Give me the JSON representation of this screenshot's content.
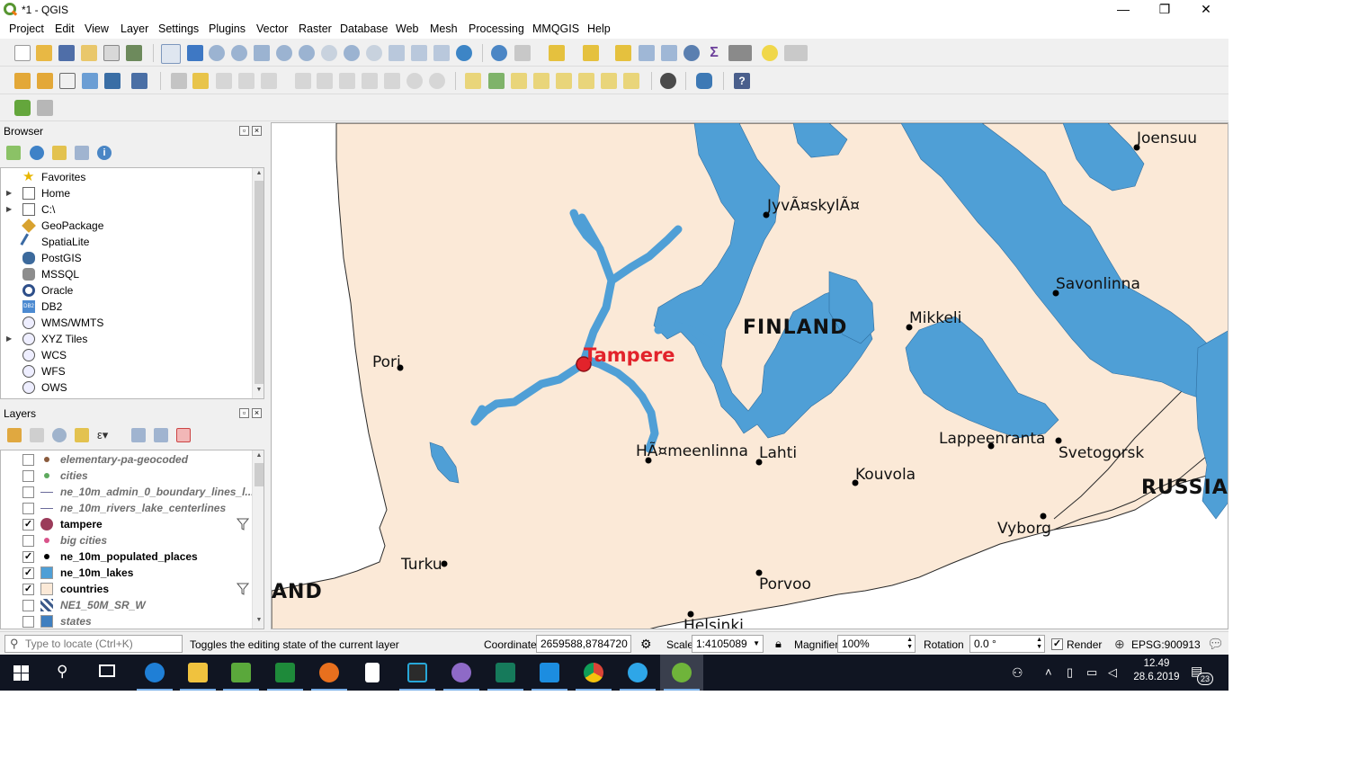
{
  "window": {
    "title": "*1 - QGIS",
    "min_glyph": "—",
    "max_glyph": "❐",
    "close_glyph": "✕"
  },
  "menu": [
    "Project",
    "Edit",
    "View",
    "Layer",
    "Settings",
    "Plugins",
    "Vector",
    "Raster",
    "Database",
    "Web",
    "Mesh",
    "Processing",
    "MMQGIS",
    "Help"
  ],
  "browser": {
    "title": "Browser",
    "items": [
      {
        "label": "Favorites",
        "icon": "star-icon",
        "expandable": false
      },
      {
        "label": "Home",
        "icon": "home-folder-icon",
        "expandable": true
      },
      {
        "label": "C:\\",
        "icon": "drive-folder-icon",
        "expandable": true
      },
      {
        "label": "GeoPackage",
        "icon": "geopackage-icon",
        "expandable": false
      },
      {
        "label": "SpatiaLite",
        "icon": "spatialite-icon",
        "expandable": false
      },
      {
        "label": "PostGIS",
        "icon": "postgis-icon",
        "expandable": false
      },
      {
        "label": "MSSQL",
        "icon": "mssql-icon",
        "expandable": false
      },
      {
        "label": "Oracle",
        "icon": "oracle-icon",
        "expandable": false
      },
      {
        "label": "DB2",
        "icon": "db2-icon",
        "expandable": false
      },
      {
        "label": "WMS/WMTS",
        "icon": "globe-icon",
        "expandable": false
      },
      {
        "label": "XYZ Tiles",
        "icon": "globe-icon",
        "expandable": true
      },
      {
        "label": "WCS",
        "icon": "globe-icon",
        "expandable": false
      },
      {
        "label": "WFS",
        "icon": "globe-icon",
        "expandable": false
      },
      {
        "label": "OWS",
        "icon": "globe-icon",
        "expandable": false
      }
    ]
  },
  "layers": {
    "title": "Layers",
    "items": [
      {
        "name": "elementary-pa-geocoded",
        "checked": false,
        "symbol": "dot",
        "color": "#8a5a3c",
        "filter": false
      },
      {
        "name": "cities",
        "checked": false,
        "symbol": "dot",
        "color": "#5ea95e",
        "filter": false
      },
      {
        "name": "ne_10m_admin_0_boundary_lines_l...",
        "checked": false,
        "symbol": "line",
        "color": "#6b6b9a",
        "filter": false
      },
      {
        "name": "ne_10m_rivers_lake_centerlines",
        "checked": false,
        "symbol": "line",
        "color": "#6b6b9a",
        "filter": false
      },
      {
        "name": "tampere",
        "checked": true,
        "symbol": "bigdot",
        "color": "#9b3b5a",
        "filter": true
      },
      {
        "name": "big cities",
        "checked": false,
        "symbol": "dot",
        "color": "#d9538a",
        "filter": false
      },
      {
        "name": "ne_10m_populated_places",
        "checked": true,
        "symbol": "dot",
        "color": "#000000",
        "filter": false
      },
      {
        "name": "ne_10m_lakes",
        "checked": true,
        "symbol": "fill",
        "color": "#4f9fd6",
        "filter": false
      },
      {
        "name": "countries",
        "checked": true,
        "symbol": "fill",
        "color": "#fbe9d7",
        "filter": true
      },
      {
        "name": "NE1_50M_SR_W",
        "checked": false,
        "symbol": "raster",
        "color": "#3c5a8a",
        "filter": false
      },
      {
        "name": "states",
        "checked": false,
        "symbol": "fill",
        "color": "#3f7fc0",
        "filter": false
      }
    ]
  },
  "map": {
    "land_color": "#fbe9d7",
    "water_color": "#4f9fd6",
    "sea_color": "#ffffff",
    "highlight_color": "#e2232b",
    "places": [
      {
        "name": "Joensuu"
      },
      {
        "name": "JyvÃ¤skylÃ¤"
      },
      {
        "name": "Savonlinna"
      },
      {
        "name": "Mikkeli"
      },
      {
        "name": "Pori"
      },
      {
        "name": "HÃ¤meenlinna"
      },
      {
        "name": "Lahti"
      },
      {
        "name": "Lappeenranta"
      },
      {
        "name": "Svetogorsk"
      },
      {
        "name": "Kouvola"
      },
      {
        "name": "Vyborg"
      },
      {
        "name": "Turku"
      },
      {
        "name": "Porvoo"
      },
      {
        "name": "Helsinki"
      }
    ],
    "countries": [
      {
        "name": "FINLAND"
      },
      {
        "name": "RUSSIA"
      },
      {
        "name": "AND"
      }
    ],
    "highlight": {
      "name": "Tampere"
    }
  },
  "status": {
    "locator_placeholder": "Type to locate (Ctrl+K)",
    "message": "Toggles the editing state of the current layer",
    "coordinate_label": "Coordinate",
    "coordinate_value": "2659588,8784720",
    "scale_label": "Scale",
    "scale_value": "1:4105089",
    "magnifier_label": "Magnifier",
    "magnifier_value": "100%",
    "rotation_label": "Rotation",
    "rotation_value": "0.0 °",
    "render_label": "Render",
    "render_checked": true,
    "crs": "EPSG:900913"
  },
  "taskbar": {
    "time": "12.49",
    "date": "28.6.2019",
    "notification_count": "23"
  }
}
